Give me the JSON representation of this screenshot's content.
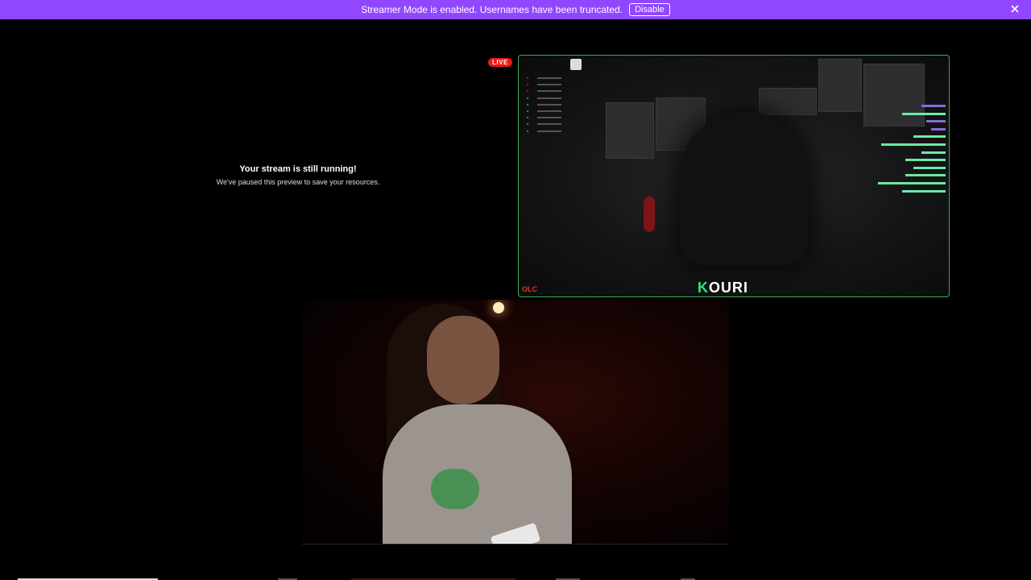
{
  "banner": {
    "message": "Streamer Mode is enabled. Usernames have been truncated.",
    "disable_label": "Disable",
    "close_icon": "close-icon",
    "color": "#9147ff"
  },
  "paused": {
    "title": "Your stream is still running!",
    "subtitle": "We've paused this preview to save your resources."
  },
  "preview": {
    "live_label": "LIVE",
    "stream_logo_k": "K",
    "stream_logo_rest": "OURI",
    "corner_text": "OLC",
    "border_color": "#3aaa52",
    "live_color": "#e91916"
  }
}
